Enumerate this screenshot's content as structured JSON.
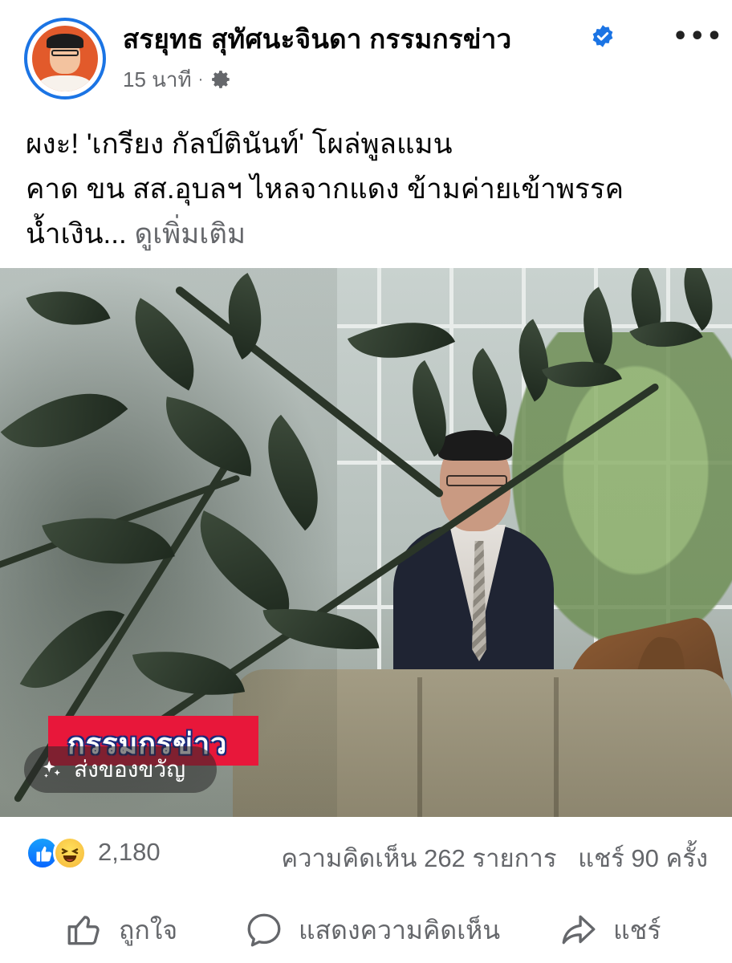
{
  "post": {
    "author_name": "สรยุทธ สุทัศนะจินดา กรรมกรข่าว",
    "time": "15 นาที",
    "text_lines": [
      "ผงะ! 'เกรียง กัลป์ตินันท์' โผล่พูลแมน",
      "คาด ขน สส.อุบลฯ ไหลจากแดง ข้ามค่ายเข้าพรรค",
      "น้ำเงิน..."
    ],
    "see_more": "ดูเพิ่มเติม"
  },
  "photo": {
    "watermark": "กรรมกรข่าว",
    "gift_button": "ส่งของขวัญ"
  },
  "engagement": {
    "reaction_count": "2,180",
    "comments": "ความคิดเห็น 262 รายการ",
    "shares": "แชร์ 90 ครั้ง"
  },
  "actions": {
    "like": "ถูกใจ",
    "comment": "แสดงความคิดเห็น",
    "share": "แชร์"
  },
  "colors": {
    "verified": "#1b74e4",
    "like_reaction": "#0866ff",
    "muted_text": "#65676b",
    "watermark_bg": "#e8173a"
  }
}
